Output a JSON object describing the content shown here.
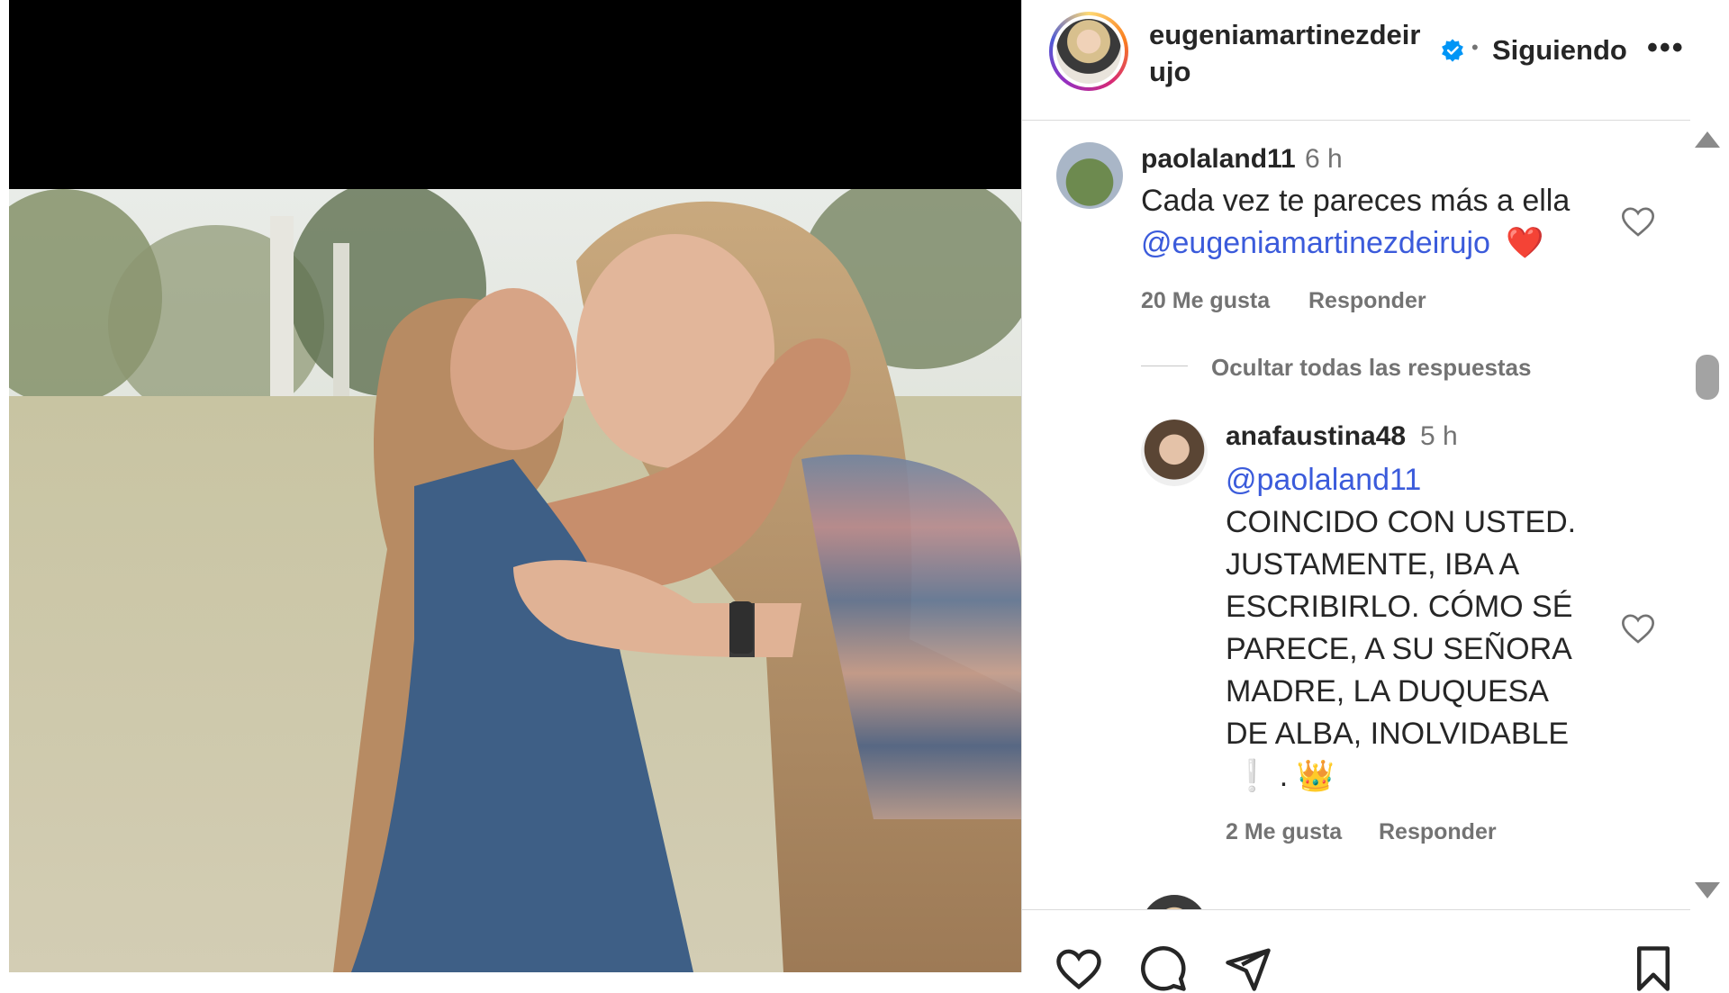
{
  "post": {
    "author": "eugeniamartinezdeirujo",
    "verified": true,
    "follow_status": "Siguiendo",
    "more_label": "•••"
  },
  "comments": [
    {
      "user": "paolaland11",
      "time": "6 h",
      "text": "Cada vez te pareces más a ella",
      "mention": "@eugeniamartinezdeirujo",
      "emoji": "❤️",
      "likes": "20 Me gusta",
      "reply_label": "Responder"
    }
  ],
  "replies_toggle": "Ocultar todas las respuestas",
  "replies": [
    {
      "user": "anafaustina48",
      "time": "5 h",
      "mention": "@paolaland11",
      "text_lines": [
        "COINCIDO CON USTED.",
        "JUSTAMENTE, IBA A",
        "ESCRIBIRLO. CÓMO SÉ",
        "PARECE, A SU SEÑORA",
        "MADRE, LA DUQUESA",
        "DE ALBA, INOLVIDABLE"
      ],
      "emoji_line": "❕ . 👑",
      "likes": "2 Me gusta",
      "reply_label": "Responder"
    }
  ],
  "icons": {
    "verified": "verified-badge-icon",
    "like": "heart-icon",
    "comment": "comment-icon",
    "share": "share-icon",
    "save": "bookmark-icon"
  },
  "colors": {
    "accent_link": "#3b5bdb",
    "verified_blue": "#0095f6",
    "muted_text": "#737373"
  }
}
